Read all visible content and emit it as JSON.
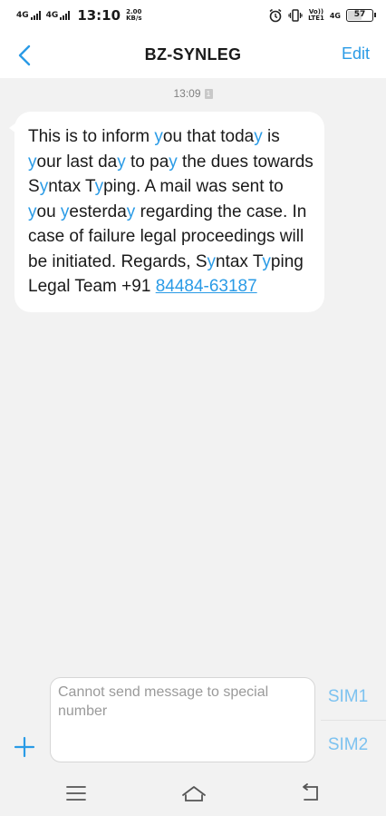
{
  "status_bar": {
    "net1": "4G",
    "net2": "4G",
    "time": "13:10",
    "speed_value": "2.00",
    "speed_unit": "KB/s",
    "volte": "Vo))",
    "lte": "LTE1",
    "net3": "4G",
    "battery": "57"
  },
  "header": {
    "title": "BZ-SYNLEG",
    "edit_label": "Edit"
  },
  "conversation": {
    "timestamp": "13:09",
    "sim_badge": "1",
    "phone": "84484-63187"
  },
  "compose": {
    "placeholder": "Cannot send message to special number",
    "sim1_label": "SIM1",
    "sim2_label": "SIM2"
  },
  "colors": {
    "accent": "#2a9be6",
    "sim_label": "#7cc2f0",
    "background": "#f2f2f2"
  }
}
